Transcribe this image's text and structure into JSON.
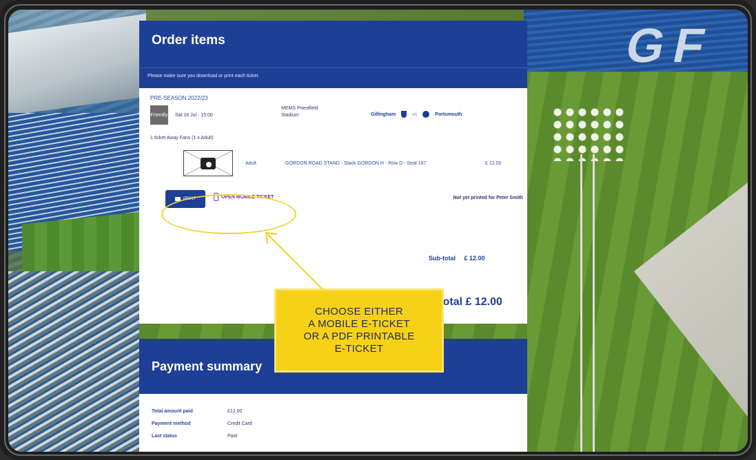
{
  "order": {
    "title": "Order items",
    "note": "Please make sure you download or print each ticket.",
    "season": "PRE-SEASON 2022/23",
    "match": {
      "badge": "Friendly",
      "datetime": "Sat 16 Jul - 15:00",
      "venue": "MEMS Priestfield Stadium",
      "home": "Gillingham",
      "vs": "vs",
      "away": "Portsmouth"
    },
    "ticket_summary": "1 ticket Away Fans (1 x Adult)",
    "ticket": {
      "type": "Adult",
      "seat": "GORDON ROAD STAND - Stack GORDON H - Row D - Seat 197",
      "price": "£ 12.00"
    },
    "actions": {
      "print_label": "PRINT",
      "mobile_label": "OPEN MOBILE TICKET",
      "status": "Not yet printed for Peter Smith"
    },
    "subtotal_label": "Sub-total",
    "subtotal_value": "£ 12.00",
    "total_label": "Total",
    "total_value": "£ 12.00"
  },
  "payment": {
    "title": "Payment summary",
    "rows": [
      {
        "label": "Total amount paid",
        "value": "£12.00"
      },
      {
        "label": "Payment method",
        "value": "Credit Card"
      },
      {
        "label": "Last status",
        "value": "Paid"
      }
    ]
  },
  "callout": {
    "lines": [
      "CHOOSE EITHER",
      "A MOBILE E-TICKET",
      "OR A PDF PRINTABLE",
      "E-TICKET"
    ]
  },
  "background": {
    "stadium_letters": "GF"
  },
  "colors": {
    "brand_blue": "#1e3f96",
    "callout_yellow": "#f7d117",
    "mobile_purple": "#8a2fb0"
  },
  "icons": [
    "printer-icon",
    "phone-icon",
    "camera-icon",
    "crest-icon"
  ]
}
